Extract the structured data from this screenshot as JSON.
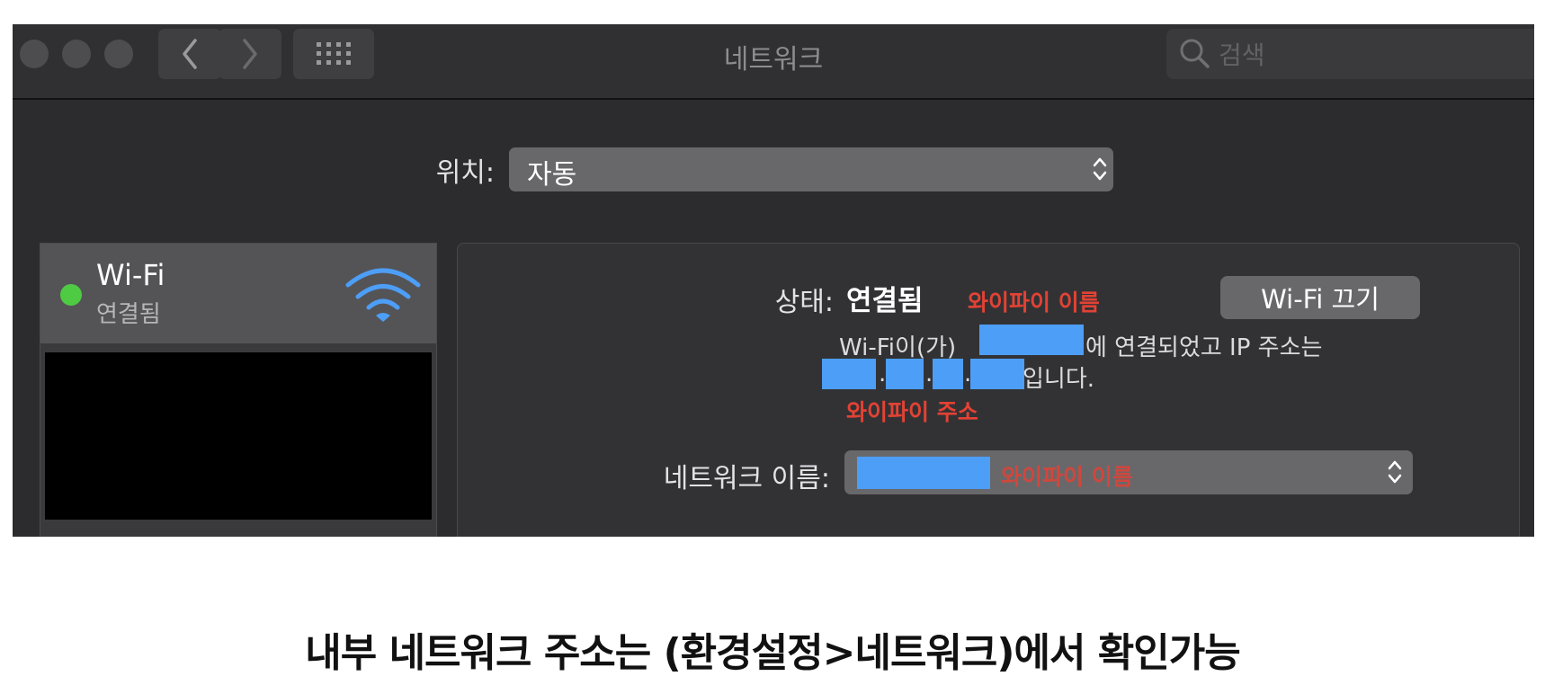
{
  "window": {
    "title": "네트워크",
    "search_placeholder": "검색"
  },
  "location": {
    "label": "위치:",
    "value": "자동"
  },
  "sidebar": {
    "items": [
      {
        "name": "Wi-Fi",
        "status": "연결됨",
        "status_color": "#4ecb43",
        "icon": "wifi-icon"
      }
    ]
  },
  "detail": {
    "status_label": "상태:",
    "status_value": "연결됨",
    "wifi_off_button": "Wi-Fi 끄기",
    "description_prefix": "Wi-Fi이(가)",
    "description_mid": "에 연결되었고 IP 주소는",
    "ip_separator": ".",
    "description_suffix": "입니다.",
    "network_name_label": "네트워크 이름:"
  },
  "annotations": {
    "wifi_name_1": "와이파이 이름",
    "wifi_address": "와이파이 주소",
    "wifi_name_2": "와이파이 이름",
    "color": "#e34234"
  },
  "caption": "내부 네트워크 주소는 (환경설정>네트워크)에서 확인가능",
  "colors": {
    "accent_blue": "#4d9ef7",
    "window_bg": "#2c2c2e",
    "connected_green": "#4ecb43"
  }
}
